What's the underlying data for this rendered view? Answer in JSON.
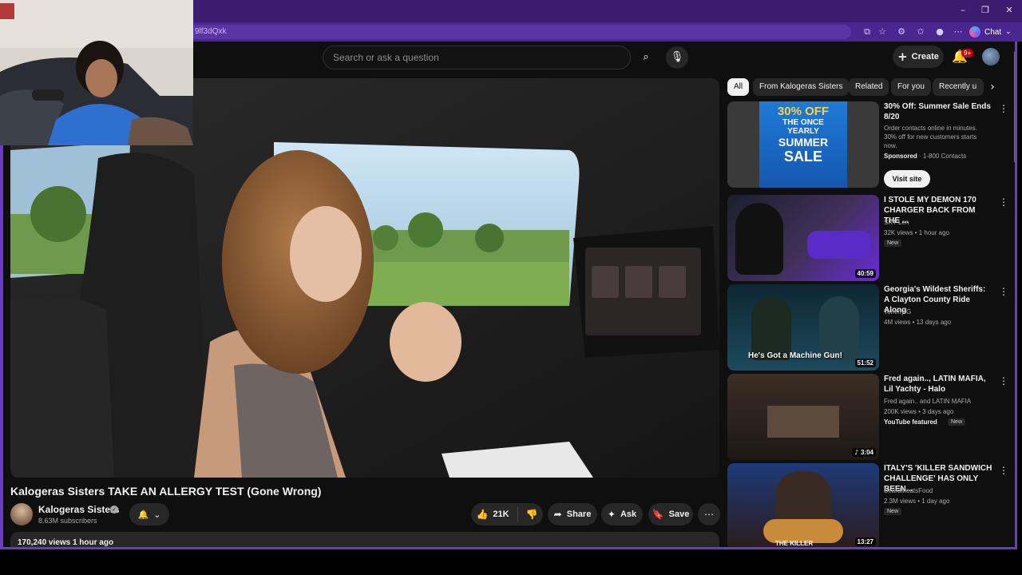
{
  "browser": {
    "url_fragment": "9lf3dQxk",
    "chat_label": "Chat",
    "notification_count": "9+"
  },
  "masthead": {
    "search_placeholder": "Search or ask a question",
    "create_label": "Create"
  },
  "video": {
    "title": "Kalogeras Sisters TAKE AN ALLERGY TEST (Gone Wrong)",
    "channel": "Kalogeras Sisters",
    "subscribers": "8.63M subscribers",
    "likes": "21K",
    "share_label": "Share",
    "ask_label": "Ask",
    "save_label": "Save",
    "views": "170,240 views",
    "uploaded": "1 hour ago",
    "views_line": "170,240 views  1 hour ago"
  },
  "chips": [
    "All",
    "From Kalogeras Sisters",
    "Related",
    "For you",
    "Recently u"
  ],
  "recommendations": [
    {
      "title": "30% Off: Summer Sale Ends 8/20",
      "desc": "Order contacts online in minutes. 30% off for new customers starts now.",
      "sponsor": "Sponsored",
      "advertiser": "1-800 Contacts",
      "cta": "Visit site",
      "thumb_text_1": "30% OFF",
      "thumb_text_2": "THE ONCE",
      "thumb_text_3": "YEARLY",
      "thumb_text_4": "SUMMER",
      "thumb_text_5": "SALE"
    },
    {
      "title": "I STOLE MY DEMON 170 CHARGER BACK FROM THE ...",
      "channel": "SRT Len",
      "meta": "32K views • 1 hour ago",
      "badge": "New",
      "duration": "40:59"
    },
    {
      "title": "Georgia's Wildest Sheriffs: A Clayton County Ride Along",
      "channel": "Tommy G",
      "meta": "4M views • 13 days ago",
      "duration": "51:52",
      "thumb_caption": "He's Got a Machine Gun!"
    },
    {
      "title": "Fred again.., LATIN MAFIA, Lil Yachty - Halo",
      "channel": "Fred again.. and LATIN MAFIA",
      "meta": "200K views • 3 days ago",
      "featured": "YouTube featured",
      "badge": "New",
      "duration": "3:04"
    },
    {
      "title": "ITALY'S 'KILLER SANDWICH CHALLENGE' HAS ONLY BEEN...",
      "channel": "BeardMeatsFood",
      "meta": "2.3M views • 1 day ago",
      "badge": "New",
      "duration": "13:27",
      "thumb_caption": "THE KILLER"
    }
  ],
  "colors": {
    "browser_frame": "#6a3bc4",
    "titlebar": "#3b1c6e",
    "page_bg": "#0f0f0f",
    "pill_bg": "#272727",
    "notification_red": "#cc0000"
  }
}
